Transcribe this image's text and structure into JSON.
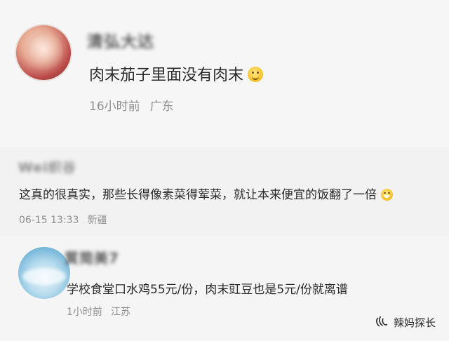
{
  "comments": [
    {
      "username": "清弘大达",
      "text": "肉末茄子里面没有肉末",
      "emoji": "smile-emoji-icon",
      "time": "16小时前",
      "location": "广东"
    },
    {
      "username": "Wei织谷",
      "text": "这真的很真实，那些长得像素菜得荤菜，就让本来便宜的饭翻了一倍",
      "emoji": "laughing-tears-emoji-icon",
      "time": "06-15 13:33",
      "location": "新疆"
    },
    {
      "username": "質简美7",
      "text": "学校食堂口水鸡55元/份，肉末豇豆也是5元/份就离谱",
      "time": "1小时前",
      "location": "江苏"
    }
  ],
  "watermark": {
    "label": "辣妈探长",
    "icon": "wechat-channel-icon"
  },
  "colors": {
    "background": "#f6f6f7",
    "text": "#2a2a2a",
    "meta": "#8f8f8f"
  }
}
